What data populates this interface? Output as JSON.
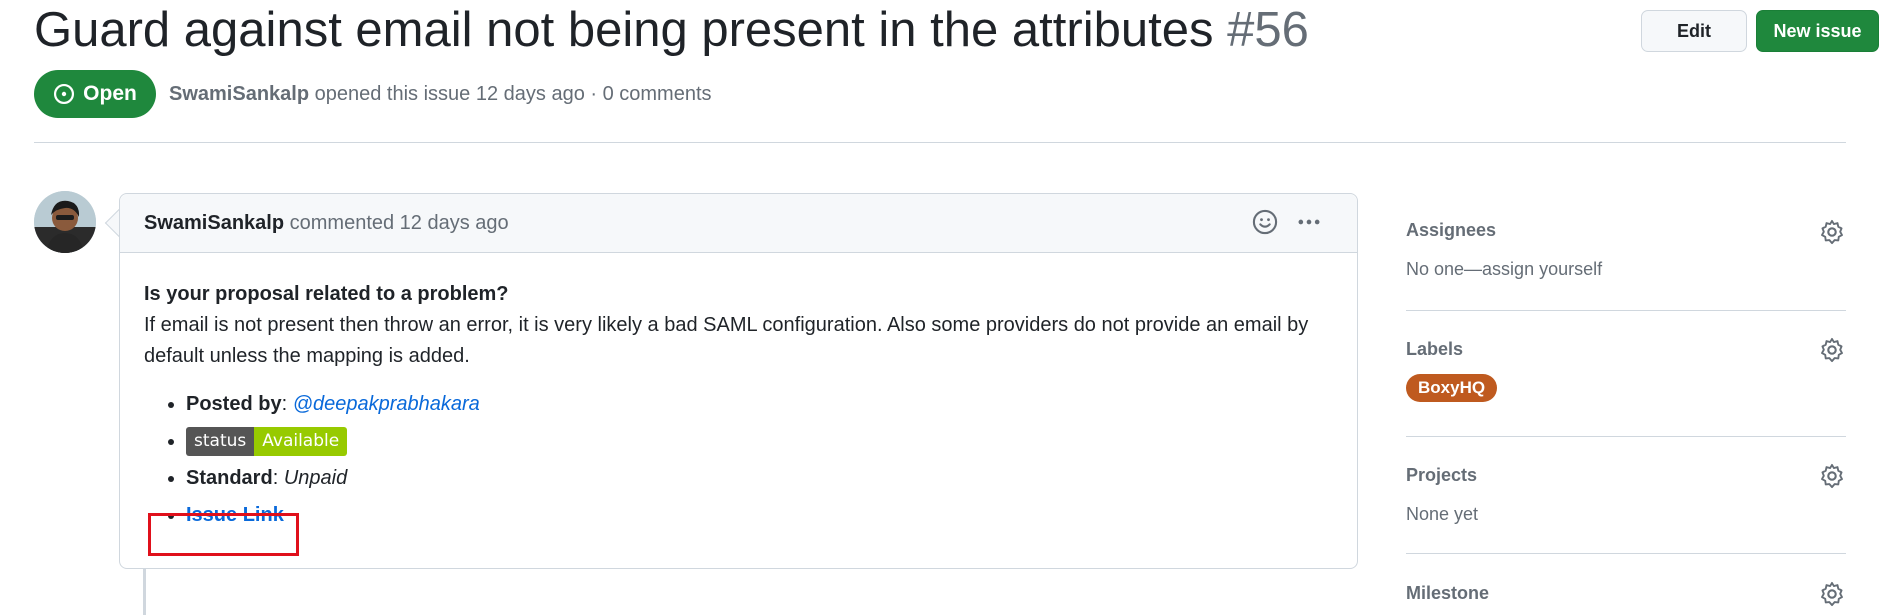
{
  "issue": {
    "title": "Guard against email not being present in the attributes",
    "number": "#56",
    "state": "Open",
    "author": "SwamiSankalp",
    "meta_suffix": "opened this issue 12 days ago · 0 comments"
  },
  "header_buttons": {
    "edit": "Edit",
    "new_issue": "New issue"
  },
  "comment": {
    "author": "SwamiSankalp",
    "meta": "commented 12 days ago",
    "question": "Is your proposal related to a problem?",
    "text": "If email is not present then throw an error, it is very likely a bad SAML configuration. Also some providers do not provide an email by default unless the mapping is added.",
    "list": {
      "posted_by_label": "Posted by",
      "posted_by_value": "@deepakprabhakara",
      "badge_left": "status",
      "badge_right": "Available",
      "standard_label": "Standard",
      "standard_value": "Unpaid",
      "issue_link": "Issue Link"
    }
  },
  "sidebar": {
    "assignees": {
      "heading": "Assignees",
      "value": "No one—assign yourself"
    },
    "labels": {
      "heading": "Labels",
      "label": "BoxyHQ"
    },
    "projects": {
      "heading": "Projects",
      "value": "None yet"
    },
    "milestone": {
      "heading": "Milestone"
    }
  },
  "colors": {
    "open_green": "#1f883d",
    "label_orange": "#bf5a1f",
    "link_blue": "#0969da",
    "highlight_red": "#e0101b",
    "badge_green": "#97ca00"
  },
  "icons": {
    "state": "issue-opened-icon",
    "reaction": "smiley-icon",
    "more": "kebab-horizontal-icon",
    "settings": "gear-icon"
  }
}
